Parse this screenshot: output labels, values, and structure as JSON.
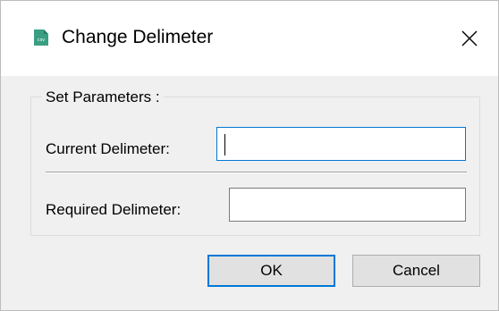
{
  "window": {
    "title": "Change Delimeter",
    "icon": "csv-file-icon",
    "icon_color": "#3a9e83",
    "icon_text": "csv",
    "close_icon": "close-icon"
  },
  "group": {
    "legend": "Set Parameters :"
  },
  "fields": {
    "current_label": "Current Delimeter:",
    "current_value": "",
    "required_label": "Required Delimeter:",
    "required_value": ""
  },
  "buttons": {
    "ok_label": "OK",
    "cancel_label": "Cancel"
  },
  "colors": {
    "focus_border": "#0078d7",
    "dialog_bg": "#f0f0f0"
  }
}
